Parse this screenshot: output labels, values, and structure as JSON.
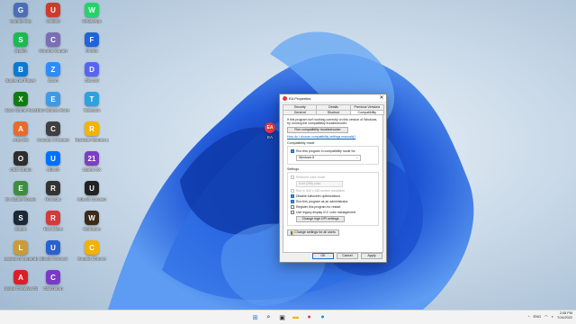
{
  "desktop": {
    "icons": [
      {
        "label": "Google Site",
        "color": "#4a6fb5",
        "glyph": "G"
      },
      {
        "label": "Spotify",
        "color": "#1db954",
        "glyph": "S"
      },
      {
        "label": "Battle.net Player",
        "color": "#0b79d0",
        "glyph": "B"
      },
      {
        "label": "Xbox Game Pass",
        "color": "#107c10",
        "glyph": "X"
      },
      {
        "label": "Ares MS",
        "color": "#e96b2c",
        "glyph": "A"
      },
      {
        "label": "OBS Studio",
        "color": "#2d2d2d",
        "glyph": "O"
      },
      {
        "label": "EA Battle Royale",
        "color": "#3e8e41",
        "glyph": "E"
      },
      {
        "label": "Steam",
        "color": "#1b2838",
        "glyph": "S"
      },
      {
        "label": "League of Legends",
        "color": "#c89b3c",
        "glyph": "L"
      },
      {
        "label": "Adobe Creative Cloud",
        "color": "#da1f26",
        "glyph": "A"
      },
      {
        "label": "Untitled",
        "color": "#cf3a2a",
        "glyph": "U"
      },
      {
        "label": "Chrome Canary",
        "color": "#7a6fb5",
        "glyph": "C"
      },
      {
        "label": "Zoom",
        "color": "#2d8cff",
        "glyph": "Z"
      },
      {
        "label": "Epic Games Store",
        "color": "#3c9be8",
        "glyph": "E"
      },
      {
        "label": "Counter AI Detect",
        "color": "#404040",
        "glyph": "C"
      },
      {
        "label": "Ubisoft",
        "color": "#0070ff",
        "glyph": "U"
      },
      {
        "label": "Rockstar",
        "color": "#333333",
        "glyph": "R"
      },
      {
        "label": "Riot Client",
        "color": "#d33a3a",
        "glyph": "R"
      },
      {
        "label": "Ubisoft Connect",
        "color": "#2a61cc",
        "glyph": "U"
      },
      {
        "label": "Clipchamp",
        "color": "#7b39c8",
        "glyph": "C"
      },
      {
        "label": "WhatsApp",
        "color": "#25d366",
        "glyph": "W"
      },
      {
        "label": "Firefox",
        "color": "#1f63d9",
        "glyph": "F"
      },
      {
        "label": "Discord",
        "color": "#5865f2",
        "glyph": "D"
      },
      {
        "label": "Telegram",
        "color": "#2aa3df",
        "glyph": "T"
      },
      {
        "label": "Rockstar Games Launcher",
        "color": "#f3b400",
        "glyph": "R"
      },
      {
        "label": "Opera GX",
        "color": "#7b3ec4",
        "glyph": "21"
      },
      {
        "label": "Ubisoft Connect",
        "color": "#222222",
        "glyph": "U"
      },
      {
        "label": "Warframe",
        "color": "#3a2a1a",
        "glyph": "W"
      },
      {
        "label": "Google Chrome",
        "color": "#f2b203",
        "glyph": "C"
      }
    ],
    "ea_shortcut": {
      "label": "EA",
      "color": "#e6383f"
    }
  },
  "dialog": {
    "title": "EA Properties",
    "close_glyph": "✕",
    "tabs_row1": [
      "Security",
      "Details",
      "Previous Versions"
    ],
    "tabs_row2": [
      "General",
      "Shortcut",
      "Compatibility"
    ],
    "active_tab": "Compatibility",
    "intro": "If this program isn't working correctly on this version of Windows, try running the compatibility troubleshooter.",
    "troubleshooter_btn": "Run compatibility troubleshooter",
    "manual_link": "How do I choose compatibility settings manually?",
    "compat_mode": {
      "group_label": "Compatibility mode",
      "checkbox_label": "Run this program in compatibility mode for:",
      "checked": true,
      "selected": "Windows 8"
    },
    "settings": {
      "group_label": "Settings",
      "reduced_color": {
        "label": "Reduced color mode",
        "checked": false,
        "disabled": true
      },
      "color_select": "8-bit (256) color",
      "run_640": {
        "label": "Run in 640 x 480 screen resolution",
        "checked": false,
        "disabled": true
      },
      "disable_fullscreen": {
        "label": "Disable fullscreen optimizations",
        "checked": true
      },
      "run_admin": {
        "label": "Run this program as an administrator",
        "checked": true
      },
      "register_restart": {
        "label": "Register this program for restart",
        "checked": false
      },
      "legacy_icc": {
        "label": "Use legacy display ICC color management",
        "checked": false
      },
      "dpi_btn": "Change high DPI settings"
    },
    "all_users_btn": "Change settings for all users",
    "ok": "OK",
    "cancel": "Cancel",
    "apply": "Apply"
  },
  "taskbar": {
    "apps": [
      {
        "name": "start",
        "glyph": "⊞",
        "color": "#1a73e8"
      },
      {
        "name": "search",
        "glyph": "⌕",
        "color": "#222222"
      },
      {
        "name": "task-view",
        "glyph": "▣",
        "color": "#333333"
      },
      {
        "name": "file-explorer",
        "glyph": "▬",
        "color": "#f3b400"
      },
      {
        "name": "ea-app",
        "glyph": "●",
        "color": "#e6383f"
      },
      {
        "name": "edge",
        "glyph": "●",
        "color": "#1c8ccf"
      }
    ],
    "chevron": "^",
    "language": "ENG",
    "time": "2:08 PM",
    "date": "7/14/2022"
  }
}
